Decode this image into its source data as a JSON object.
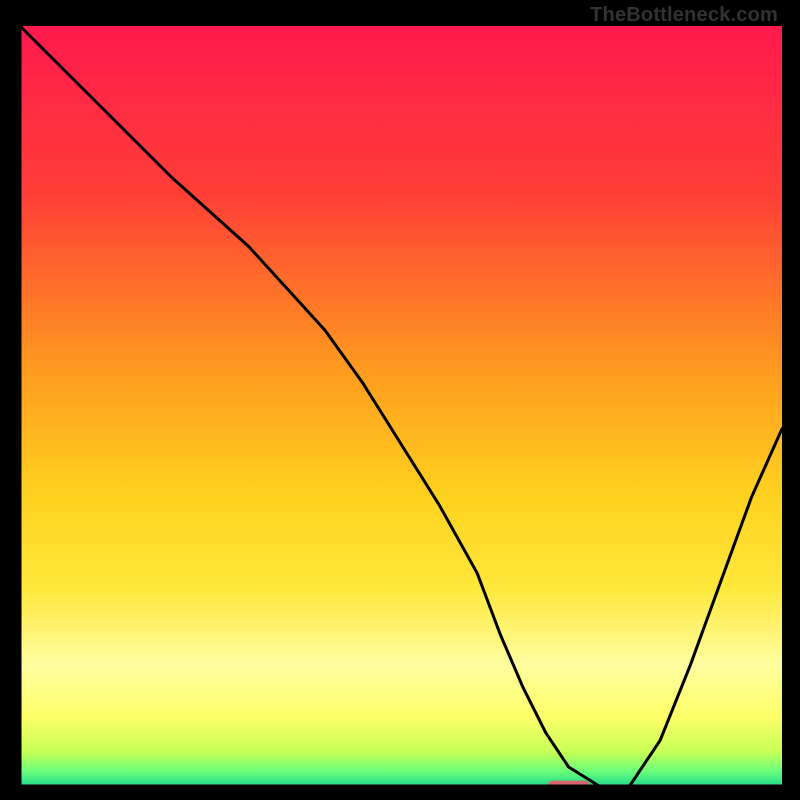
{
  "header": {
    "site": "TheBottleneck.com"
  },
  "chart_data": {
    "type": "line",
    "title": "",
    "xlabel": "",
    "ylabel": "",
    "xlim": [
      0,
      100
    ],
    "ylim": [
      0,
      100
    ],
    "gradient_stops": [
      {
        "offset": 0,
        "color": "#ff1a4d"
      },
      {
        "offset": 22,
        "color": "#ff3e37"
      },
      {
        "offset": 45,
        "color": "#ff9a1f"
      },
      {
        "offset": 62,
        "color": "#ffd21f"
      },
      {
        "offset": 74,
        "color": "#ffe83c"
      },
      {
        "offset": 84,
        "color": "#fffda0"
      },
      {
        "offset": 91,
        "color": "#fdff68"
      },
      {
        "offset": 95.5,
        "color": "#c7ff55"
      },
      {
        "offset": 98,
        "color": "#6dff7a"
      },
      {
        "offset": 100,
        "color": "#1fd98a"
      }
    ],
    "series": [
      {
        "name": "curve",
        "x": [
          0,
          10,
          20,
          30,
          40,
          45,
          50,
          55,
          60,
          63,
          66,
          69,
          72,
          76,
          80,
          84,
          88,
          92,
          96,
          100
        ],
        "y": [
          100,
          90,
          80,
          71,
          60,
          53,
          45,
          37,
          28,
          20,
          13,
          7,
          2.5,
          0,
          0,
          6,
          16,
          27,
          38,
          47
        ]
      }
    ],
    "marker": {
      "x": 72,
      "y": 0,
      "width_pct": 5.5,
      "height_pct": 1.4,
      "color": "#d9666e"
    },
    "axes_color": "#000000",
    "line_color": "#000000"
  }
}
